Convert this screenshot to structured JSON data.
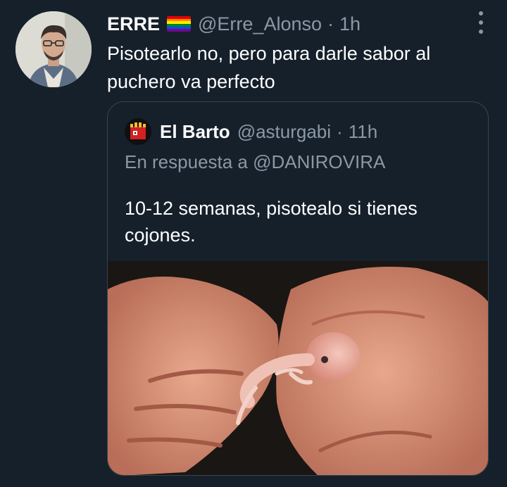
{
  "tweet": {
    "display_name": "ERRE",
    "handle": "@Erre_Alonso",
    "separator": "·",
    "time": "1h",
    "flag_icon": "rainbow-flag-icon",
    "text": "Pisotearlo no, pero para darle sabor al puchero va perfecto"
  },
  "quoted_tweet": {
    "display_name": "El Barto",
    "handle": "@asturgabi",
    "separator": "·",
    "time": "11h",
    "reply_to": "En respuesta a @DANIROVIRA",
    "text": "10-12 semanas, pisotealo si tienes cojones."
  },
  "colors": {
    "background": "#15202b",
    "muted_text": "#8b98a5",
    "border": "#38444d"
  }
}
